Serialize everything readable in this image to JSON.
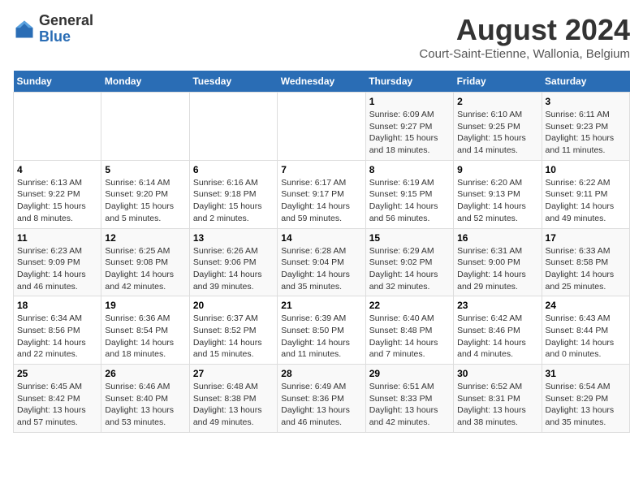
{
  "header": {
    "logo_general": "General",
    "logo_blue": "Blue",
    "title": "August 2024",
    "subtitle": "Court-Saint-Etienne, Wallonia, Belgium"
  },
  "days_of_week": [
    "Sunday",
    "Monday",
    "Tuesday",
    "Wednesday",
    "Thursday",
    "Friday",
    "Saturday"
  ],
  "weeks": [
    [
      {
        "day": "",
        "info": ""
      },
      {
        "day": "",
        "info": ""
      },
      {
        "day": "",
        "info": ""
      },
      {
        "day": "",
        "info": ""
      },
      {
        "day": "1",
        "info": "Sunrise: 6:09 AM\nSunset: 9:27 PM\nDaylight: 15 hours and 18 minutes."
      },
      {
        "day": "2",
        "info": "Sunrise: 6:10 AM\nSunset: 9:25 PM\nDaylight: 15 hours and 14 minutes."
      },
      {
        "day": "3",
        "info": "Sunrise: 6:11 AM\nSunset: 9:23 PM\nDaylight: 15 hours and 11 minutes."
      }
    ],
    [
      {
        "day": "4",
        "info": "Sunrise: 6:13 AM\nSunset: 9:22 PM\nDaylight: 15 hours and 8 minutes."
      },
      {
        "day": "5",
        "info": "Sunrise: 6:14 AM\nSunset: 9:20 PM\nDaylight: 15 hours and 5 minutes."
      },
      {
        "day": "6",
        "info": "Sunrise: 6:16 AM\nSunset: 9:18 PM\nDaylight: 15 hours and 2 minutes."
      },
      {
        "day": "7",
        "info": "Sunrise: 6:17 AM\nSunset: 9:17 PM\nDaylight: 14 hours and 59 minutes."
      },
      {
        "day": "8",
        "info": "Sunrise: 6:19 AM\nSunset: 9:15 PM\nDaylight: 14 hours and 56 minutes."
      },
      {
        "day": "9",
        "info": "Sunrise: 6:20 AM\nSunset: 9:13 PM\nDaylight: 14 hours and 52 minutes."
      },
      {
        "day": "10",
        "info": "Sunrise: 6:22 AM\nSunset: 9:11 PM\nDaylight: 14 hours and 49 minutes."
      }
    ],
    [
      {
        "day": "11",
        "info": "Sunrise: 6:23 AM\nSunset: 9:09 PM\nDaylight: 14 hours and 46 minutes."
      },
      {
        "day": "12",
        "info": "Sunrise: 6:25 AM\nSunset: 9:08 PM\nDaylight: 14 hours and 42 minutes."
      },
      {
        "day": "13",
        "info": "Sunrise: 6:26 AM\nSunset: 9:06 PM\nDaylight: 14 hours and 39 minutes."
      },
      {
        "day": "14",
        "info": "Sunrise: 6:28 AM\nSunset: 9:04 PM\nDaylight: 14 hours and 35 minutes."
      },
      {
        "day": "15",
        "info": "Sunrise: 6:29 AM\nSunset: 9:02 PM\nDaylight: 14 hours and 32 minutes."
      },
      {
        "day": "16",
        "info": "Sunrise: 6:31 AM\nSunset: 9:00 PM\nDaylight: 14 hours and 29 minutes."
      },
      {
        "day": "17",
        "info": "Sunrise: 6:33 AM\nSunset: 8:58 PM\nDaylight: 14 hours and 25 minutes."
      }
    ],
    [
      {
        "day": "18",
        "info": "Sunrise: 6:34 AM\nSunset: 8:56 PM\nDaylight: 14 hours and 22 minutes."
      },
      {
        "day": "19",
        "info": "Sunrise: 6:36 AM\nSunset: 8:54 PM\nDaylight: 14 hours and 18 minutes."
      },
      {
        "day": "20",
        "info": "Sunrise: 6:37 AM\nSunset: 8:52 PM\nDaylight: 14 hours and 15 minutes."
      },
      {
        "day": "21",
        "info": "Sunrise: 6:39 AM\nSunset: 8:50 PM\nDaylight: 14 hours and 11 minutes."
      },
      {
        "day": "22",
        "info": "Sunrise: 6:40 AM\nSunset: 8:48 PM\nDaylight: 14 hours and 7 minutes."
      },
      {
        "day": "23",
        "info": "Sunrise: 6:42 AM\nSunset: 8:46 PM\nDaylight: 14 hours and 4 minutes."
      },
      {
        "day": "24",
        "info": "Sunrise: 6:43 AM\nSunset: 8:44 PM\nDaylight: 14 hours and 0 minutes."
      }
    ],
    [
      {
        "day": "25",
        "info": "Sunrise: 6:45 AM\nSunset: 8:42 PM\nDaylight: 13 hours and 57 minutes."
      },
      {
        "day": "26",
        "info": "Sunrise: 6:46 AM\nSunset: 8:40 PM\nDaylight: 13 hours and 53 minutes."
      },
      {
        "day": "27",
        "info": "Sunrise: 6:48 AM\nSunset: 8:38 PM\nDaylight: 13 hours and 49 minutes."
      },
      {
        "day": "28",
        "info": "Sunrise: 6:49 AM\nSunset: 8:36 PM\nDaylight: 13 hours and 46 minutes."
      },
      {
        "day": "29",
        "info": "Sunrise: 6:51 AM\nSunset: 8:33 PM\nDaylight: 13 hours and 42 minutes."
      },
      {
        "day": "30",
        "info": "Sunrise: 6:52 AM\nSunset: 8:31 PM\nDaylight: 13 hours and 38 minutes."
      },
      {
        "day": "31",
        "info": "Sunrise: 6:54 AM\nSunset: 8:29 PM\nDaylight: 13 hours and 35 minutes."
      }
    ]
  ]
}
